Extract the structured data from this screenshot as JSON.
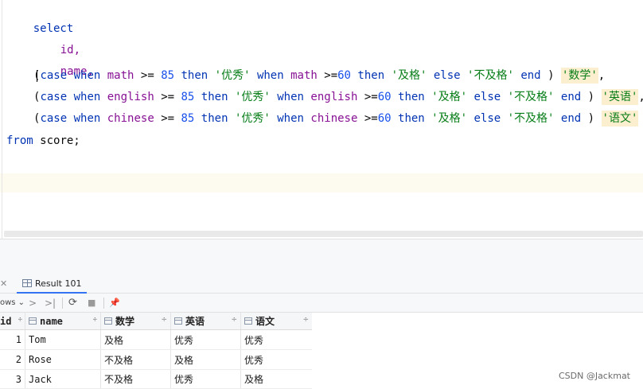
{
  "editor": {
    "line1": "select",
    "line2": "id,",
    "line3": "name,",
    "kw_case": "case",
    "kw_when": "when",
    "kw_then": "then",
    "kw_else": "else",
    "kw_end": "end",
    "kw_from": "from",
    "col_math": "math",
    "col_english": "english",
    "col_chinese": "chinese",
    "op_ge": ">=",
    "num_85": "85",
    "num_60": "60",
    "str_excellent": "'优秀'",
    "str_pass": "'及格'",
    "str_fail": "'不及格'",
    "alias_math": "'数学'",
    "alias_english": "'英语'",
    "alias_chinese": "'语文'",
    "open_paren": "(",
    "close_paren": ")",
    "comma": ",",
    "table_name": "score;"
  },
  "tabbar": {
    "close_glyph": "✕",
    "tab_label": "Result 101"
  },
  "toolbar": {
    "rows_label": "ows ⌄",
    "next_glyph": ">",
    "last_glyph": ">|",
    "refresh_glyph": "⟳",
    "stop_glyph": "■",
    "pin_glyph": "📌"
  },
  "grid": {
    "columns": [
      "id",
      "name",
      "数学",
      "英语",
      "语文"
    ],
    "sort_glyph": "÷",
    "rows": [
      {
        "id": "1",
        "name": "Tom",
        "math": "及格",
        "english": "优秀",
        "chinese": "优秀"
      },
      {
        "id": "2",
        "name": "Rose",
        "math": "不及格",
        "english": "及格",
        "chinese": "优秀"
      },
      {
        "id": "3",
        "name": "Jack",
        "math": "不及格",
        "english": "优秀",
        "chinese": "及格"
      }
    ]
  },
  "watermark": "CSDN @Jackmat"
}
